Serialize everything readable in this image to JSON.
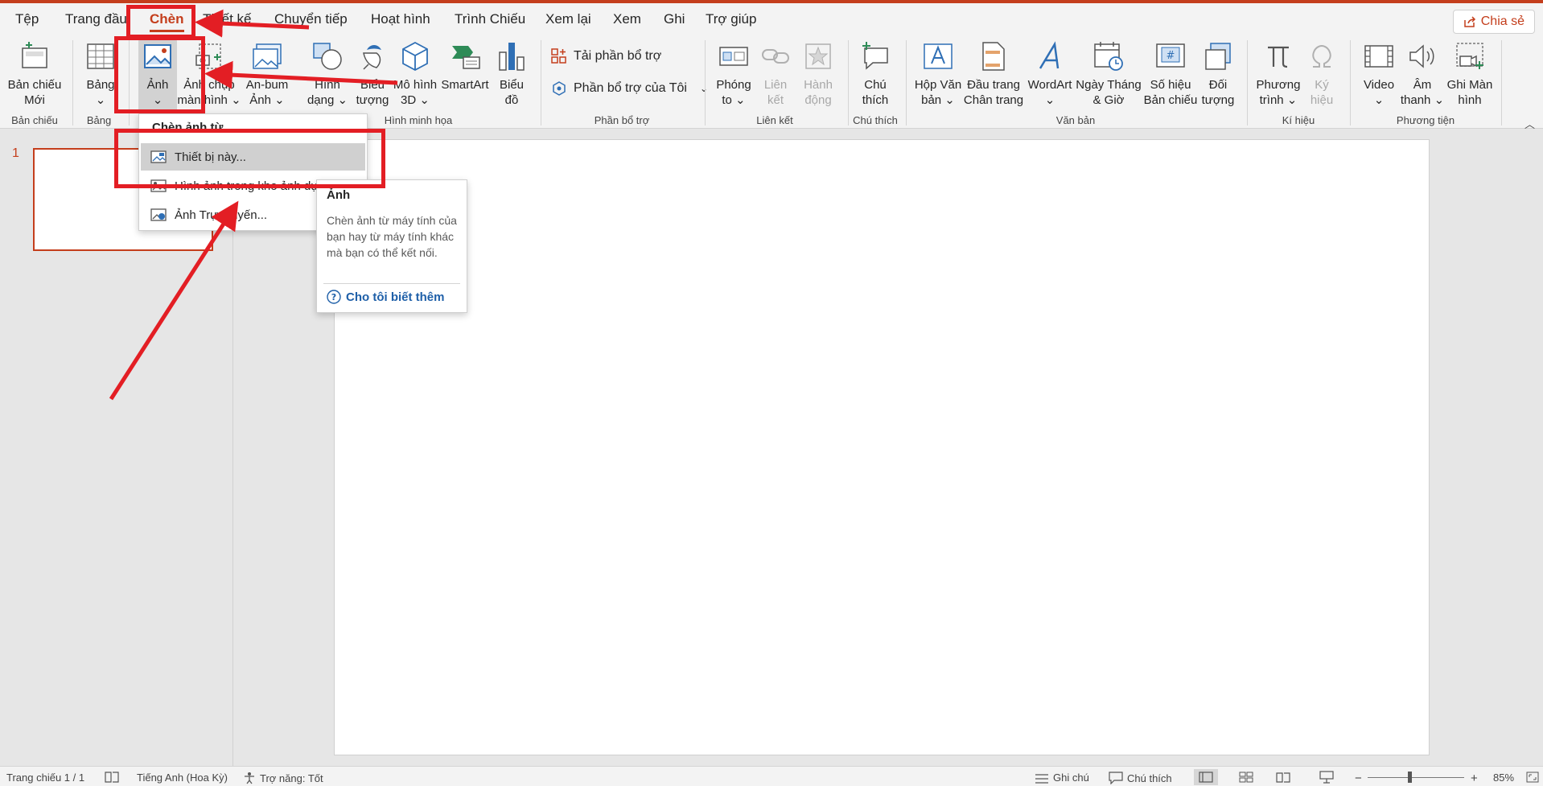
{
  "tabs": [
    {
      "label": "Tệp"
    },
    {
      "label": "Trang đầu"
    },
    {
      "label": "Chèn"
    },
    {
      "label": "Thiết kế"
    },
    {
      "label": "Chuyển tiếp"
    },
    {
      "label": "Hoạt hình"
    },
    {
      "label": "Trình Chiếu"
    },
    {
      "label": "Xem lại"
    },
    {
      "label": "Xem"
    },
    {
      "label": "Ghi"
    },
    {
      "label": "Trợ giúp"
    }
  ],
  "active_tab": "Chèn",
  "share_label": "Chia sẻ",
  "ribbon": {
    "new_slide": [
      "Bản chiếu",
      "Mới"
    ],
    "table": "Bảng",
    "picture": "Ảnh",
    "screenshot": [
      "Ảnh chụp",
      "màn hình"
    ],
    "album": [
      "An-bum",
      "Ảnh"
    ],
    "shapes": [
      "Hình",
      "dạng"
    ],
    "icons": [
      "Biểu",
      "tượng"
    ],
    "models3d": [
      "Mô hình",
      "3D"
    ],
    "smartart": "SmartArt",
    "chart": [
      "Biểu",
      "đồ"
    ],
    "get_addins": "Tải phần bổ trợ",
    "my_addins": "Phần bổ trợ của Tôi",
    "zoom": [
      "Phóng",
      "to"
    ],
    "link": [
      "Liên",
      "kết"
    ],
    "action": [
      "Hành",
      "động"
    ],
    "comment": [
      "Chú",
      "thích"
    ],
    "textbox": [
      "Hộp Văn",
      "bản"
    ],
    "header_footer": [
      "Đầu trang",
      "Chân trang"
    ],
    "wordart": "WordArt",
    "datetime": [
      "Ngày Tháng",
      "& Giờ"
    ],
    "slide_number": [
      "Số hiệu",
      "Bản chiếu"
    ],
    "object": [
      "Đối",
      "tượng"
    ],
    "equation": [
      "Phương",
      "trình"
    ],
    "symbol": [
      "Ký",
      "hiệu"
    ],
    "video": "Video",
    "audio": [
      "Âm",
      "thanh"
    ],
    "screen_recording": [
      "Ghi Màn",
      "hình"
    ]
  },
  "groups": {
    "slides": "Bản chiếu",
    "tables": "Bảng",
    "illustrations": "Hình minh họa",
    "addins": "Phần bổ trợ",
    "links": "Liên kết",
    "comments": "Chú thích",
    "text": "Văn bản",
    "symbols": "Kí hiệu",
    "media": "Phương tiện"
  },
  "menu": {
    "header": "Chèn ảnh từ",
    "items": [
      "Thiết bị này...",
      "Hình ảnh trong kho ảnh dự...",
      "Ảnh Trực tuyến..."
    ]
  },
  "tooltip": {
    "title": "Ảnh",
    "body": "Chèn ảnh từ máy tính của bạn hay từ máy tính khác mà bạn có thể kết nối.",
    "link": "Cho tôi biết thêm"
  },
  "thumbnail": {
    "number": "1"
  },
  "status": {
    "slide_count": "Trang chiếu 1 / 1",
    "language": "Tiếng Anh (Hoa Kỳ)",
    "accessibility": "Trợ năng: Tốt",
    "notes": "Ghi chú",
    "comments": "Chú thích",
    "zoom": "85%"
  },
  "colors": {
    "accent": "#c43e1c",
    "annotation": "#e31e24"
  }
}
